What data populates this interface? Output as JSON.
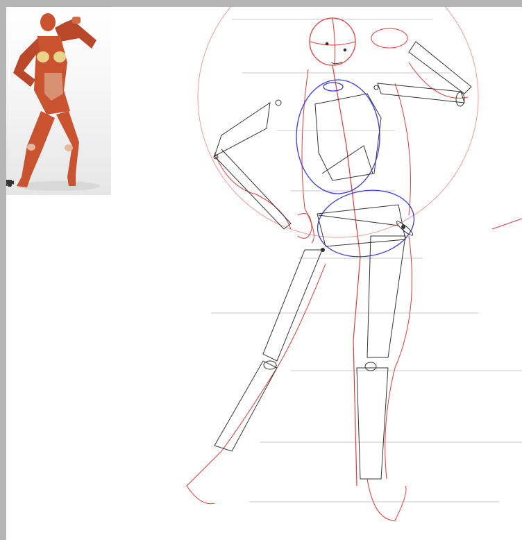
{
  "reference_panel": {
    "toolbar": [
      {
        "name": "eye-icon"
      },
      {
        "name": "layout-icon"
      },
      {
        "name": "figure-icon"
      },
      {
        "name": "camera-icon"
      },
      {
        "name": "light-icon"
      }
    ]
  },
  "colors": {
    "background": "#b4b4b4",
    "paper": "#ffffff",
    "sketch_red": "#e23a3a",
    "sketch_blue": "#3a3adf",
    "sketch_black": "#333333",
    "guide_grey": "#bdbdbd",
    "muscle": "#c9532e"
  }
}
